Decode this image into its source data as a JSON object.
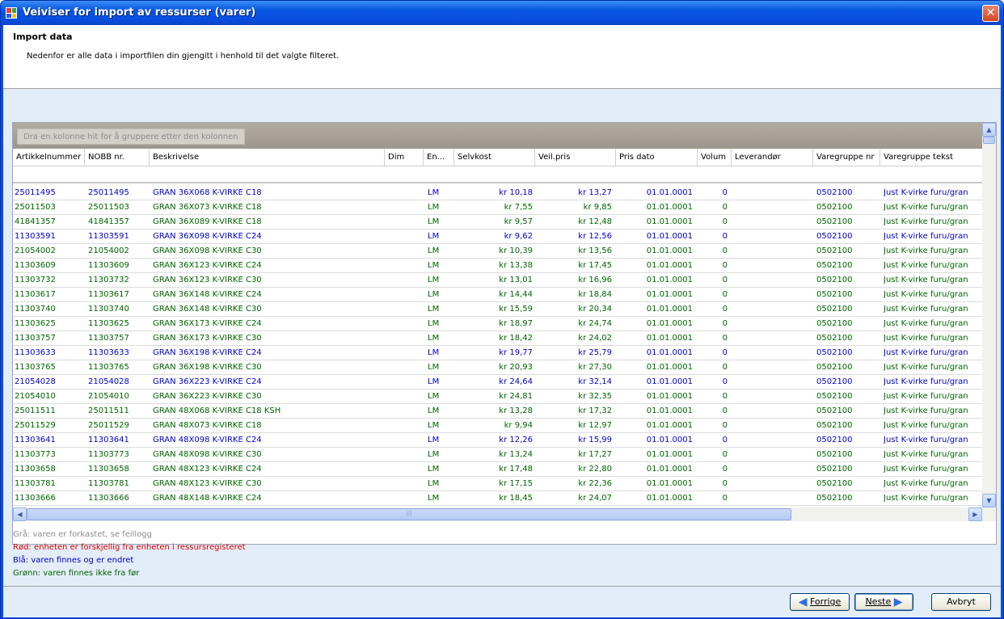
{
  "window": {
    "title": "Veiviser for import av ressurser (varer)",
    "close": "✕"
  },
  "header": {
    "title": "Import data",
    "description": "Nedenfor er alle data i importfilen din gjengitt i henhold til det valgte filteret."
  },
  "grid": {
    "group_hint": "Dra en kolonne hit for å gruppere etter den kolonnen",
    "columns": [
      "Artikkelnummer",
      "NOBB nr.",
      "Beskrivelse",
      "Dim",
      "En...",
      "Selvkost",
      "Veil.pris",
      "Pris dato",
      "Volum",
      "Leverandør",
      "Varegruppe nr",
      "Varegruppe tekst"
    ],
    "rows": [
      {
        "color": "#0000c8",
        "artnr": "25011495",
        "nobb": "25011495",
        "desc": "GRAN 36X068 K-VIRKE C18",
        "unit": "LM",
        "cost": "kr 10,18",
        "price": "kr 13,27",
        "date": "01.01.0001",
        "vol": "0",
        "grp": "0502100",
        "grptxt": "Just K-virke furu/gran"
      },
      {
        "color": "#006400",
        "artnr": "25011503",
        "nobb": "25011503",
        "desc": "GRAN 36X073 K-VIRKE C18",
        "unit": "LM",
        "cost": "kr 7,55",
        "price": "kr 9,85",
        "date": "01.01.0001",
        "vol": "0",
        "grp": "0502100",
        "grptxt": "Just K-virke furu/gran"
      },
      {
        "color": "#006400",
        "artnr": "41841357",
        "nobb": "41841357",
        "desc": "GRAN 36X089 K-VIRKE C18",
        "unit": "LM",
        "cost": "kr 9,57",
        "price": "kr 12,48",
        "date": "01.01.0001",
        "vol": "0",
        "grp": "0502100",
        "grptxt": "Just K-virke furu/gran"
      },
      {
        "color": "#0000c8",
        "artnr": "11303591",
        "nobb": "11303591",
        "desc": "GRAN 36X098 K-VIRKE C24",
        "unit": "LM",
        "cost": "kr 9,62",
        "price": "kr 12,56",
        "date": "01.01.0001",
        "vol": "0",
        "grp": "0502100",
        "grptxt": "Just K-virke furu/gran"
      },
      {
        "color": "#006400",
        "artnr": "21054002",
        "nobb": "21054002",
        "desc": "GRAN 36X098 K-VIRKE C30",
        "unit": "LM",
        "cost": "kr 10,39",
        "price": "kr 13,56",
        "date": "01.01.0001",
        "vol": "0",
        "grp": "0502100",
        "grptxt": "Just K-virke furu/gran"
      },
      {
        "color": "#006400",
        "artnr": "11303609",
        "nobb": "11303609",
        "desc": "GRAN 36X123 K-VIRKE C24",
        "unit": "LM",
        "cost": "kr 13,38",
        "price": "kr 17,45",
        "date": "01.01.0001",
        "vol": "0",
        "grp": "0502100",
        "grptxt": "Just K-virke furu/gran"
      },
      {
        "color": "#006400",
        "artnr": "11303732",
        "nobb": "11303732",
        "desc": "GRAN 36X123 K-VIRKE C30",
        "unit": "LM",
        "cost": "kr 13,01",
        "price": "kr 16,96",
        "date": "01.01.0001",
        "vol": "0",
        "grp": "0502100",
        "grptxt": "Just K-virke furu/gran"
      },
      {
        "color": "#006400",
        "artnr": "11303617",
        "nobb": "11303617",
        "desc": "GRAN 36X148 K-VIRKE C24",
        "unit": "LM",
        "cost": "kr 14,44",
        "price": "kr 18,84",
        "date": "01.01.0001",
        "vol": "0",
        "grp": "0502100",
        "grptxt": "Just K-virke furu/gran"
      },
      {
        "color": "#006400",
        "artnr": "11303740",
        "nobb": "11303740",
        "desc": "GRAN 36X148 K-VIRKE C30",
        "unit": "LM",
        "cost": "kr 15,59",
        "price": "kr 20,34",
        "date": "01.01.0001",
        "vol": "0",
        "grp": "0502100",
        "grptxt": "Just K-virke furu/gran"
      },
      {
        "color": "#006400",
        "artnr": "11303625",
        "nobb": "11303625",
        "desc": "GRAN 36X173 K-VIRKE C24",
        "unit": "LM",
        "cost": "kr 18,97",
        "price": "kr 24,74",
        "date": "01.01.0001",
        "vol": "0",
        "grp": "0502100",
        "grptxt": "Just K-virke furu/gran"
      },
      {
        "color": "#006400",
        "artnr": "11303757",
        "nobb": "11303757",
        "desc": "GRAN 36X173 K-VIRKE C30",
        "unit": "LM",
        "cost": "kr 18,42",
        "price": "kr 24,02",
        "date": "01.01.0001",
        "vol": "0",
        "grp": "0502100",
        "grptxt": "Just K-virke furu/gran"
      },
      {
        "color": "#0000c8",
        "artnr": "11303633",
        "nobb": "11303633",
        "desc": "GRAN 36X198 K-VIRKE C24",
        "unit": "LM",
        "cost": "kr 19,77",
        "price": "kr 25,79",
        "date": "01.01.0001",
        "vol": "0",
        "grp": "0502100",
        "grptxt": "Just K-virke furu/gran"
      },
      {
        "color": "#006400",
        "artnr": "11303765",
        "nobb": "11303765",
        "desc": "GRAN 36X198 K-VIRKE C30",
        "unit": "LM",
        "cost": "kr 20,93",
        "price": "kr 27,30",
        "date": "01.01.0001",
        "vol": "0",
        "grp": "0502100",
        "grptxt": "Just K-virke furu/gran"
      },
      {
        "color": "#0000c8",
        "artnr": "21054028",
        "nobb": "21054028",
        "desc": "GRAN 36X223 K-VIRKE C24",
        "unit": "LM",
        "cost": "kr 24,64",
        "price": "kr 32,14",
        "date": "01.01.0001",
        "vol": "0",
        "grp": "0502100",
        "grptxt": "Just K-virke furu/gran"
      },
      {
        "color": "#006400",
        "artnr": "21054010",
        "nobb": "21054010",
        "desc": "GRAN 36X223 K-VIRKE C30",
        "unit": "LM",
        "cost": "kr 24,81",
        "price": "kr 32,35",
        "date": "01.01.0001",
        "vol": "0",
        "grp": "0502100",
        "grptxt": "Just K-virke furu/gran"
      },
      {
        "color": "#006400",
        "artnr": "25011511",
        "nobb": "25011511",
        "desc": "GRAN 48X068 K-VIRKE C18 KSH",
        "unit": "LM",
        "cost": "kr 13,28",
        "price": "kr 17,32",
        "date": "01.01.0001",
        "vol": "0",
        "grp": "0502100",
        "grptxt": "Just K-virke furu/gran"
      },
      {
        "color": "#006400",
        "artnr": "25011529",
        "nobb": "25011529",
        "desc": "GRAN 48X073 K-VIRKE C18",
        "unit": "LM",
        "cost": "kr 9,94",
        "price": "kr 12,97",
        "date": "01.01.0001",
        "vol": "0",
        "grp": "0502100",
        "grptxt": "Just K-virke furu/gran"
      },
      {
        "color": "#0000c8",
        "artnr": "11303641",
        "nobb": "11303641",
        "desc": "GRAN 48X098 K-VIRKE C24",
        "unit": "LM",
        "cost": "kr 12,26",
        "price": "kr 15,99",
        "date": "01.01.0001",
        "vol": "0",
        "grp": "0502100",
        "grptxt": "Just K-virke furu/gran"
      },
      {
        "color": "#006400",
        "artnr": "11303773",
        "nobb": "11303773",
        "desc": "GRAN 48X098 K-VIRKE C30",
        "unit": "LM",
        "cost": "kr 13,24",
        "price": "kr 17,27",
        "date": "01.01.0001",
        "vol": "0",
        "grp": "0502100",
        "grptxt": "Just K-virke furu/gran"
      },
      {
        "color": "#006400",
        "artnr": "11303658",
        "nobb": "11303658",
        "desc": "GRAN 48X123 K-VIRKE C24",
        "unit": "LM",
        "cost": "kr 17,48",
        "price": "kr 22,80",
        "date": "01.01.0001",
        "vol": "0",
        "grp": "0502100",
        "grptxt": "Just K-virke furu/gran"
      },
      {
        "color": "#006400",
        "artnr": "11303781",
        "nobb": "11303781",
        "desc": "GRAN 48X123 K-VIRKE C30",
        "unit": "LM",
        "cost": "kr 17,15",
        "price": "kr 22,36",
        "date": "01.01.0001",
        "vol": "0",
        "grp": "0502100",
        "grptxt": "Just K-virke furu/gran"
      },
      {
        "color": "#006400",
        "artnr": "11303666",
        "nobb": "11303666",
        "desc": "GRAN 48X148 K-VIRKE C24",
        "unit": "LM",
        "cost": "kr 18,45",
        "price": "kr 24,07",
        "date": "01.01.0001",
        "vol": "0",
        "grp": "0502100",
        "grptxt": "Just K-virke furu/gran"
      }
    ],
    "scroll_up": "▲",
    "scroll_down": "▼",
    "scroll_left": "◀",
    "scroll_right": "▶",
    "hthumb_grip": "|||",
    "vthumb_grip": "≡"
  },
  "legend": [
    {
      "text": "Grå: varen er forkastet, se feillogg",
      "color": "#8c8c8c"
    },
    {
      "text": "Rød: enheten er forskjellig fra enheten i ressursregisteret",
      "color": "#e00000"
    },
    {
      "text": "Blå: varen finnes og er endret",
      "color": "#0000c8"
    },
    {
      "text": "Grønn: varen finnes ikke fra før",
      "color": "#006400"
    }
  ],
  "buttons": {
    "back": "Forrige",
    "next": "Neste",
    "cancel": "Avbryt",
    "back_icon": "left-arrow-icon",
    "next_icon": "right-arrow-icon"
  },
  "colors": {
    "titlebar": "#0a4ee0",
    "client": "#e3edf8",
    "blue_row": "#0000c8",
    "green_row": "#006400"
  }
}
